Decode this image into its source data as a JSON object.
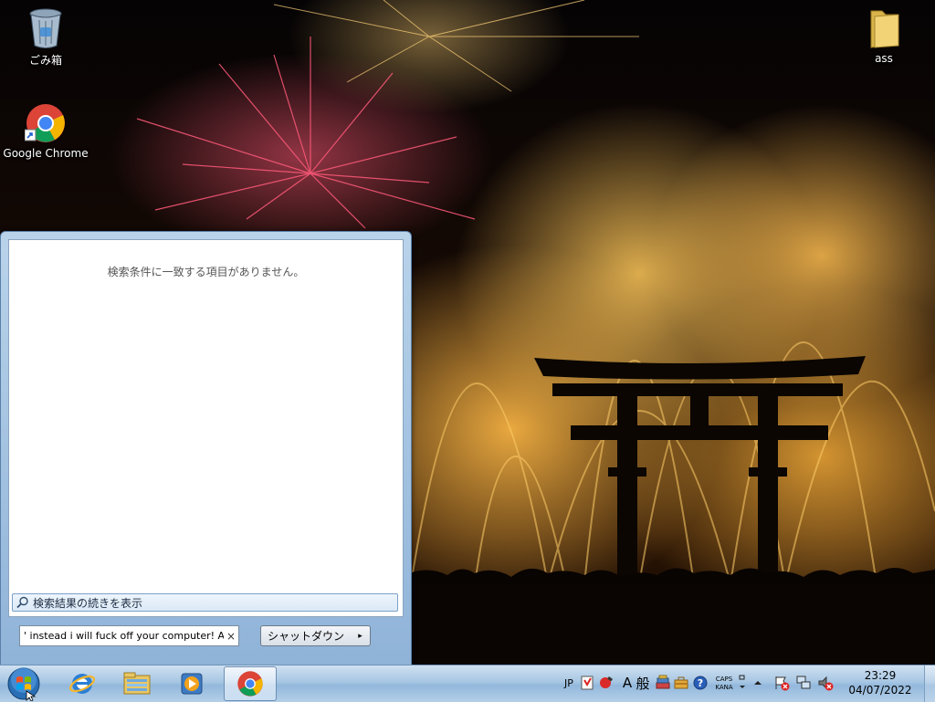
{
  "desktop": {
    "icons": [
      {
        "label": "ごみ箱",
        "icon": "recycle-bin-icon"
      },
      {
        "label": "Google Chrome",
        "icon": "chrome-icon"
      },
      {
        "label": "ass",
        "icon": "folder-icon"
      }
    ]
  },
  "start_menu": {
    "no_results_text": "検索条件に一致する項目がありません。",
    "see_more_results": "検索結果の続きを表示",
    "search_value": "' instead i will fuck off your computer! A",
    "clear_glyph": "×",
    "shutdown_label": "シャットダウン",
    "shutdown_arrow": "▸"
  },
  "taskbar": {
    "pinned": [
      {
        "name": "internet-explorer",
        "icon": "ie-icon"
      },
      {
        "name": "windows-explorer",
        "icon": "explorer-folder-icon"
      },
      {
        "name": "media-player",
        "icon": "media-player-icon"
      },
      {
        "name": "google-chrome",
        "icon": "chrome-icon",
        "active": true
      }
    ],
    "tray": {
      "language": "JP",
      "ime_mode": "A",
      "ime_kanji": "般",
      "caps": "CAPS",
      "kana": "KANA",
      "help": "?"
    },
    "clock": {
      "time": "23:29",
      "date": "04/07/2022"
    }
  },
  "colors": {
    "taskbar": "#a7c6e3",
    "start_menu_frame": "#9fbfe0",
    "search_bar": "#dbe9f7"
  }
}
